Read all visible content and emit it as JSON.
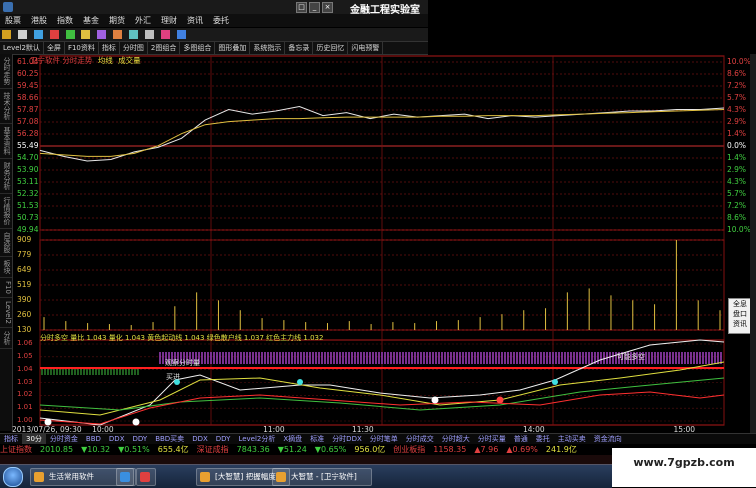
{
  "window": {
    "title": "金融工程实验室",
    "menu": [
      "股票",
      "港股",
      "指数",
      "基金",
      "期货",
      "外汇",
      "理财",
      "资讯",
      "委托"
    ]
  },
  "toolbar2": [
    "Level2默认",
    "全屏",
    "F10资料",
    "指标",
    "分时图",
    "2图组合",
    "多图组合",
    "图形叠加",
    "系统指示",
    "备忘录",
    "历史回忆",
    "闪电预警"
  ],
  "left_tabs": [
    "分时走势",
    "技术分析",
    "基本资料",
    "财务分析",
    "行情报价",
    "自选股",
    "板块",
    "F10",
    "Level2",
    "分析"
  ],
  "chart_data": {
    "type": "line",
    "title": "卫宁软件 分时走势",
    "legend": [
      {
        "label": "卫宁软件 分时走势",
        "color": "#e04040"
      },
      {
        "label": "均线",
        "color": "#f0e040"
      },
      {
        "label": "成交量",
        "color": "#f0e040"
      }
    ],
    "price_ticks": [
      "61.04",
      "60.25",
      "59.45",
      "58.66",
      "57.87",
      "57.08",
      "56.28",
      "55.49",
      "54.70",
      "53.90",
      "53.11",
      "52.32",
      "51.53",
      "50.73",
      "49.94"
    ],
    "pct_ticks": [
      "10.0%",
      "8.6%",
      "7.2%",
      "5.7%",
      "4.3%",
      "2.9%",
      "1.4%",
      "0.0%",
      "1.4%",
      "2.9%",
      "4.3%",
      "5.7%",
      "7.2%",
      "8.6%",
      "10.0%"
    ],
    "volume_ticks": [
      "909",
      "779",
      "649",
      "519",
      "390",
      "260",
      "130"
    ],
    "indicator_ticks": [
      "1.06",
      "1.05",
      "1.04",
      "1.03",
      "1.02",
      "1.01",
      "1.00"
    ],
    "x_ticks": [
      "2013/07/26, 09:30",
      "10:00",
      "11:00",
      "11:30",
      "14:00",
      "15:00"
    ],
    "price_line": [
      55.2,
      54.8,
      54.5,
      54.6,
      55.1,
      55.4,
      56.0,
      57.2,
      57.9,
      57.6,
      57.8,
      58.1,
      57.5,
      57.7,
      57.3,
      57.6,
      57.4,
      57.5,
      57.6,
      57.3,
      57.5,
      57.4,
      57.5,
      57.6,
      57.7,
      57.8,
      57.8,
      57.9,
      57.9,
      58.0
    ],
    "avg_line": [
      55.0,
      54.9,
      54.8,
      54.8,
      55.0,
      55.5,
      56.3,
      56.9,
      57.1,
      57.2,
      57.3,
      57.3,
      57.35,
      57.4,
      57.4,
      57.4,
      57.4,
      57.45,
      57.45,
      57.5,
      57.5,
      57.5,
      57.55,
      57.6,
      57.65,
      57.7,
      57.75,
      57.8,
      57.85,
      57.9
    ],
    "volume": [
      130,
      90,
      70,
      60,
      50,
      80,
      240,
      380,
      300,
      200,
      120,
      100,
      80,
      70,
      90,
      60,
      80,
      70,
      90,
      100,
      130,
      160,
      200,
      220,
      380,
      420,
      350,
      300,
      260,
      909,
      300,
      200
    ],
    "indicator_legend": "分时多空 量比 1.043 量化 1.043 黄色起动线 1.043 绿色散户线 1.037 红色主力线 1.032",
    "annotations": [
      "观察分时量",
      "可能多空",
      "买进"
    ]
  },
  "bottom_tabs": [
    "指标",
    "30分",
    "分时资金",
    "BBD",
    "DDX",
    "DDY",
    "BBD买卖",
    "DDX",
    "DDY",
    "Level2分析",
    "X摘盘",
    "标准",
    "分时DDX",
    "分时笔单",
    "分时成交",
    "分时超大",
    "分时买量",
    "普通",
    "委托",
    "主动买卖",
    "资金流向"
  ],
  "ticker": [
    {
      "label": "上证指数",
      "color": "#e04040"
    },
    {
      "label": "2010.85",
      "color": "#40d040"
    },
    {
      "label": "▼10.32",
      "color": "#40d040"
    },
    {
      "label": "▼0.51%",
      "color": "#40d040"
    },
    {
      "label": "655.4亿",
      "color": "#e0e040"
    },
    {
      "label": "深证成指",
      "color": "#e04040"
    },
    {
      "label": "7843.36",
      "color": "#40d040"
    },
    {
      "label": "▼51.24",
      "color": "#40d040"
    },
    {
      "label": "▼0.65%",
      "color": "#40d040"
    },
    {
      "label": "956.0亿",
      "color": "#e0e040"
    },
    {
      "label": "创业板指",
      "color": "#e04040"
    },
    {
      "label": "1158.35",
      "color": "#e04040"
    },
    {
      "label": "▲7.96",
      "color": "#e04040"
    },
    {
      "label": "▲0.69%",
      "color": "#e04040"
    },
    {
      "label": "241.9亿",
      "color": "#e0e040"
    }
  ],
  "taskbar_items": [
    "生活常用软件",
    "[大智慧] 把握幅度...",
    "大智慧 - [卫宁软件]"
  ],
  "watermark": "www.7gpzb.com",
  "right_panel": [
    "全息",
    "盘口",
    "资讯"
  ]
}
